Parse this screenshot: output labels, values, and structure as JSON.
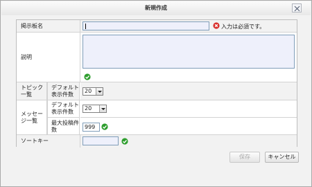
{
  "dialog": {
    "title": "新規作成",
    "close_icon": "close-icon"
  },
  "form": {
    "board_name": {
      "label": "掲示板名",
      "value": "",
      "error_icon": "error-x-icon",
      "error_text": "入力は必須です。",
      "error_color": "#d9302c"
    },
    "description": {
      "label": "説明",
      "value": "",
      "ok_icon": "check-icon",
      "ok_color": "#2e9e2e"
    },
    "topic_list": {
      "label": "トピック一覧",
      "default_count_label": "デフォルト表示件数",
      "default_count_value": "20"
    },
    "message_list": {
      "label": "メッセージ一覧",
      "default_count_label": "デフォルト表示件数",
      "default_count_value": "20",
      "max_posts_label": "最大投稿件数",
      "max_posts_value": "999"
    },
    "sort_key": {
      "label": "ソートキー",
      "value": ""
    }
  },
  "buttons": {
    "save_label": "保存",
    "cancel_label": "キャンセル"
  }
}
